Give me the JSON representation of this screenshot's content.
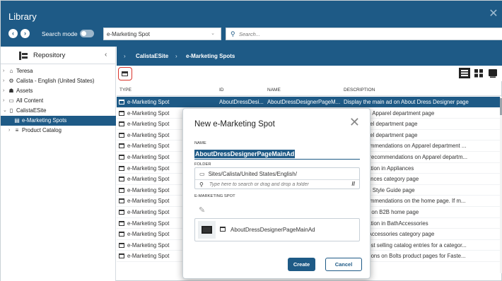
{
  "app": {
    "title": "Library",
    "close_icon": "close-icon"
  },
  "header": {
    "search_mode_label": "Search mode",
    "type_select_value": "e-Marketing Spot",
    "search_placeholder": "Search..."
  },
  "sidebar": {
    "title": "Repository",
    "items": [
      {
        "label": "Teresa",
        "icon": "home-icon",
        "toggle": "›",
        "glyph": "⌂"
      },
      {
        "label": "Calista - English (United States)",
        "icon": "site-icon",
        "toggle": "›",
        "glyph": "⚙"
      },
      {
        "label": "Assets",
        "icon": "assets-icon",
        "toggle": "›",
        "glyph": "☗"
      },
      {
        "label": "All Content",
        "icon": "folder-icon",
        "toggle": "›",
        "glyph": "▭"
      },
      {
        "label": "CalistaESite",
        "icon": "store-icon",
        "toggle": "⌄",
        "glyph": "▯"
      },
      {
        "label": "e-Marketing Spots",
        "icon": "spot-icon",
        "toggle": "",
        "glyph": "▤"
      },
      {
        "label": "Product Catalog",
        "icon": "catalog-icon",
        "toggle": "›",
        "glyph": "≡"
      }
    ]
  },
  "breadcrumb": {
    "items": [
      "CalistaESite",
      "e-Marketing Spots"
    ],
    "sep": "›"
  },
  "table": {
    "columns": [
      "TYPE",
      "ID",
      "NAME",
      "DESCRIPTION"
    ],
    "rows": [
      {
        "type": "e-Marketing Spot",
        "id": "AboutDressDesi...",
        "name": "AboutDressDesignerPageM...",
        "desc": "Display the main ad on About Dress Designer page"
      },
      {
        "type": "e-Marketing Spot",
        "id": "",
        "name": "",
        "desc": "main ad on Apparel department page"
      },
      {
        "type": "e-Marketing Spot",
        "id": "",
        "name": "",
        "desc": "s on Apparel department page"
      },
      {
        "type": "e-Marketing Spot",
        "id": "",
        "name": "",
        "desc": "s on Apparel department page"
      },
      {
        "type": "e-Marketing Spot",
        "id": "",
        "name": "",
        "desc": "egory recommendations on Apparel department ..."
      },
      {
        "type": "e-Marketing Spot",
        "id": "",
        "name": "",
        "desc": "alog entry recommendations on Apparel departm..."
      },
      {
        "type": "e-Marketing Spot",
        "id": "",
        "name": "",
        "desc": "commendation in Appliances"
      },
      {
        "type": "e-Marketing Spot",
        "id": "",
        "name": "",
        "desc": "s on Appliances category page"
      },
      {
        "type": "e-Marketing Spot",
        "id": "",
        "name": "",
        "desc": "main ad on Style Guide page"
      },
      {
        "type": "e-Marketing Spot",
        "id": "",
        "name": "",
        "desc": "egory recommendations on the home page. If m..."
      },
      {
        "type": "e-Marketing Spot",
        "id": "",
        "name": "",
        "desc": "bestsellers on B2B home page"
      },
      {
        "type": "e-Marketing Spot",
        "id": "",
        "name": "",
        "desc": "commendation in BathAccessories"
      },
      {
        "type": "e-Marketing Spot",
        "id": "",
        "name": "",
        "desc": "s on Bath Accessories category page"
      },
      {
        "type": "e-Marketing Spot",
        "id": "",
        "name": "",
        "desc": "st of the best selling catalog entries for a categor..."
      },
      {
        "type": "e-Marketing Spot",
        "id": "",
        "name": "",
        "desc": "ommendations on Bolts product pages for Faste..."
      }
    ]
  },
  "dialog": {
    "title": "New e-Marketing Spot",
    "name_label": "NAME",
    "name_value": "AboutDressDesignerPageMainAd",
    "folder_label": "FOLDER",
    "folder_path": "Sites/Calista/United States/English/",
    "folder_placeholder": "Type here to search or drag and drop a folder",
    "spot_label": "E-MARKETING SPOT",
    "spot_name": "AboutDressDesignerPageMainAd",
    "create_label": "Create",
    "cancel_label": "Cancel"
  },
  "colors": {
    "brand": "#1e5a86",
    "highlight": "#d9342b"
  }
}
